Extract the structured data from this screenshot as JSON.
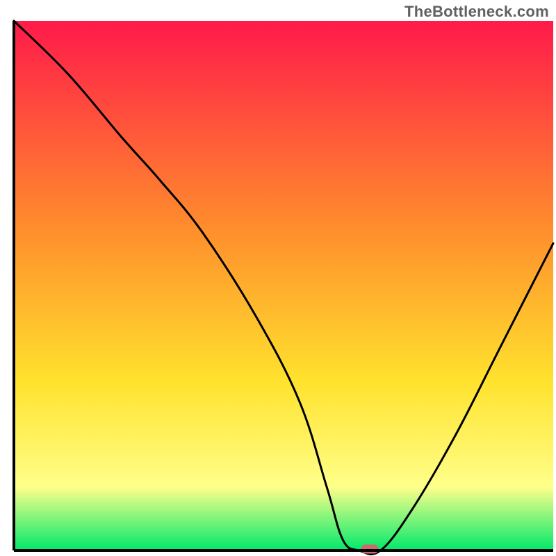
{
  "watermark": "TheBottleneck.com",
  "colors": {
    "gradient_top": "#ff1a4a",
    "gradient_mid1": "#ff8a2d",
    "gradient_mid2": "#ffe22d",
    "gradient_mid3": "#ffff8a",
    "gradient_bottom": "#00e96b",
    "curve": "#000000",
    "axes": "#000000",
    "marker_fill": "#d06a6a",
    "marker_stroke": "#d06a6a"
  },
  "chart_data": {
    "type": "line",
    "title": "",
    "xlabel": "",
    "ylabel": "",
    "xlim": [
      0,
      100
    ],
    "ylim": [
      0,
      100
    ],
    "x": [
      0,
      10,
      20,
      27,
      35,
      45,
      53,
      58,
      61,
      64,
      68,
      74,
      82,
      90,
      100
    ],
    "series": [
      {
        "name": "bottleneck-curve",
        "values": [
          100,
          90,
          78,
          70,
          60,
          44,
          28,
          12,
          2,
          0,
          0,
          8,
          22,
          38,
          58
        ]
      }
    ],
    "marker": {
      "x": 66,
      "y": 0
    },
    "grid": false,
    "legend": false
  }
}
